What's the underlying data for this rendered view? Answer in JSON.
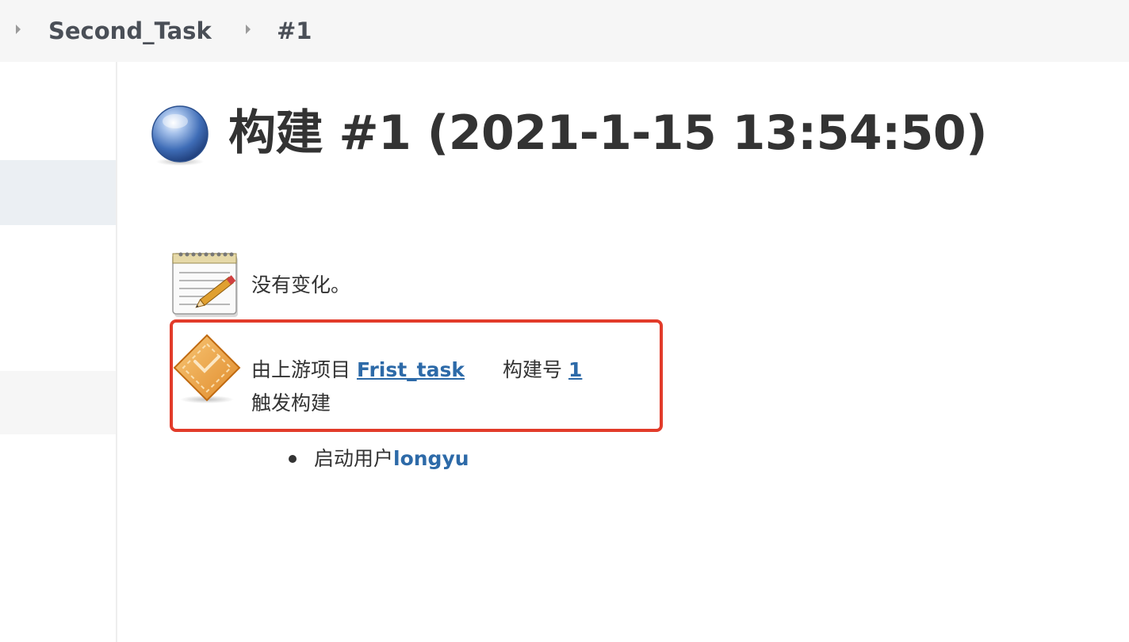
{
  "breadcrumb": {
    "items": [
      {
        "label": "Second_Task"
      },
      {
        "label": "#1"
      }
    ]
  },
  "sidebar": {
    "items": [
      {
        "state": "active"
      },
      {
        "state": "hover"
      }
    ]
  },
  "build": {
    "title": "构建 #1 (2021-1-15 13:54:50)",
    "status_icon": "blue-ball-icon",
    "status_color": "#3f6db7"
  },
  "changes": {
    "icon": "notepad-icon",
    "text": "没有变化。"
  },
  "cause": {
    "icon": "upstream-diamond-icon",
    "prefix": "由上游项目",
    "upstream_project": "Frist_task",
    "build_number_label": "构建号",
    "build_number": "1",
    "suffix": "触发构建",
    "highlight_color": "#e23b2a"
  },
  "started_by": {
    "label": "启动用户",
    "user": "longyu"
  },
  "colors": {
    "link": "#2d6aa8",
    "text": "#333333",
    "breadcrumb_bg": "#f6f6f6"
  }
}
